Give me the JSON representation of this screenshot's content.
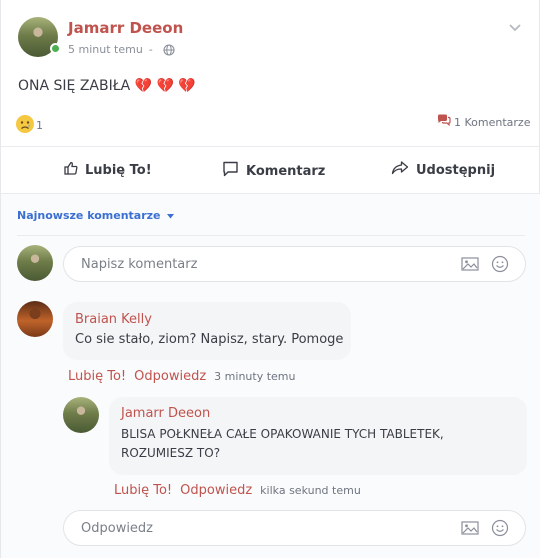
{
  "post": {
    "author": "Jamarr Deeon",
    "time": "5 minut temu",
    "separator": "-",
    "text": "ONA SIĘ ZABIŁA 💔 💔 💔",
    "reaction_count": "1",
    "comments_count": "1 Komentarze"
  },
  "actions": {
    "like": "Lubię To!",
    "comment": "Komentarz",
    "share": "Udostępnij"
  },
  "sort_label": "Najnowsze komentarze",
  "comment_input": {
    "placeholder": "Napisz komentarz"
  },
  "comments": [
    {
      "author": "Braian Kelly",
      "text": "Co sie stało, ziom? Napisz, stary. Pomoge",
      "like": "Lubię To!",
      "reply": "Odpowiedz",
      "time": "3 minuty temu"
    }
  ],
  "replies": [
    {
      "author": "Jamarr Deeon",
      "text_line1": "BLISA POŁKNEŁA CAŁE OPAKOWANIE TYCH TABLETEK,",
      "text_line2": "ROZUMIESZ TO?",
      "like": "Lubię To!",
      "reply": "Odpowiedz",
      "time": "kilka sekund temu"
    }
  ],
  "reply_input": {
    "placeholder": "Odpowiedz"
  },
  "colors": {
    "accent_red": "#c0534d",
    "link_blue": "#3b6fd1",
    "online_green": "#4caf50"
  }
}
